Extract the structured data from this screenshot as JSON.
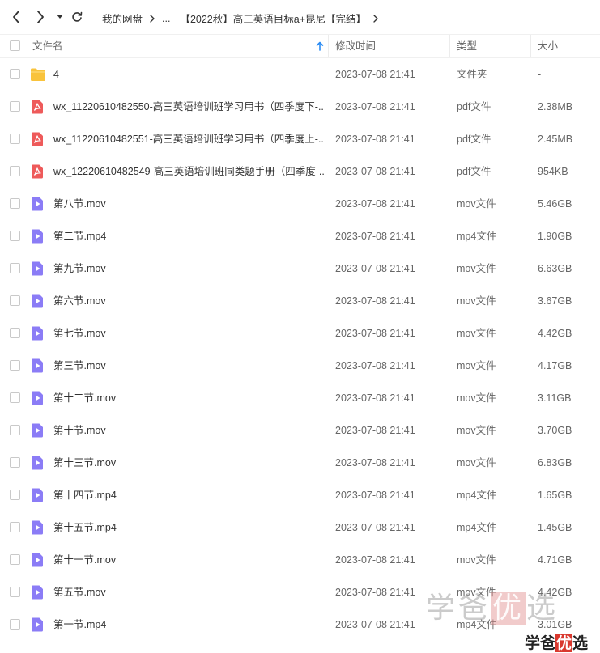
{
  "toolbar": {
    "back_icon": "chevron-left-icon",
    "forward_icon": "chevron-right-icon",
    "history_icon": "caret-down-icon",
    "refresh_icon": "refresh-icon"
  },
  "breadcrumb": {
    "items": [
      "我的网盘",
      "...",
      "【2022秋】高三英语目标a+昆尼【完结】"
    ]
  },
  "table": {
    "headers": {
      "name": "文件名",
      "modified": "修改时间",
      "type": "类型",
      "size": "大小"
    },
    "sort_icon": "arrow-up-icon",
    "rows": [
      {
        "icon": "folder-icon",
        "name": "4",
        "modified": "2023-07-08 21:41",
        "type": "文件夹",
        "size": "-"
      },
      {
        "icon": "pdf-icon",
        "name": "wx_11220610482550-高三英语培训班学习用书（四季度下-...",
        "modified": "2023-07-08 21:41",
        "type": "pdf文件",
        "size": "2.38MB"
      },
      {
        "icon": "pdf-icon",
        "name": "wx_11220610482551-高三英语培训班学习用书（四季度上-...",
        "modified": "2023-07-08 21:41",
        "type": "pdf文件",
        "size": "2.45MB"
      },
      {
        "icon": "pdf-icon",
        "name": "wx_12220610482549-高三英语培训班同类题手册（四季度-...",
        "modified": "2023-07-08 21:41",
        "type": "pdf文件",
        "size": "954KB"
      },
      {
        "icon": "video-icon",
        "name": "第八节.mov",
        "modified": "2023-07-08 21:41",
        "type": "mov文件",
        "size": "5.46GB"
      },
      {
        "icon": "video-icon",
        "name": "第二节.mp4",
        "modified": "2023-07-08 21:41",
        "type": "mp4文件",
        "size": "1.90GB"
      },
      {
        "icon": "video-icon",
        "name": "第九节.mov",
        "modified": "2023-07-08 21:41",
        "type": "mov文件",
        "size": "6.63GB"
      },
      {
        "icon": "video-icon",
        "name": "第六节.mov",
        "modified": "2023-07-08 21:41",
        "type": "mov文件",
        "size": "3.67GB"
      },
      {
        "icon": "video-icon",
        "name": "第七节.mov",
        "modified": "2023-07-08 21:41",
        "type": "mov文件",
        "size": "4.42GB"
      },
      {
        "icon": "video-icon",
        "name": "第三节.mov",
        "modified": "2023-07-08 21:41",
        "type": "mov文件",
        "size": "4.17GB"
      },
      {
        "icon": "video-icon",
        "name": "第十二节.mov",
        "modified": "2023-07-08 21:41",
        "type": "mov文件",
        "size": "3.11GB"
      },
      {
        "icon": "video-icon",
        "name": "第十节.mov",
        "modified": "2023-07-08 21:41",
        "type": "mov文件",
        "size": "3.70GB"
      },
      {
        "icon": "video-icon",
        "name": "第十三节.mov",
        "modified": "2023-07-08 21:41",
        "type": "mov文件",
        "size": "6.83GB"
      },
      {
        "icon": "video-icon",
        "name": "第十四节.mp4",
        "modified": "2023-07-08 21:41",
        "type": "mp4文件",
        "size": "1.65GB"
      },
      {
        "icon": "video-icon",
        "name": "第十五节.mp4",
        "modified": "2023-07-08 21:41",
        "type": "mp4文件",
        "size": "1.45GB"
      },
      {
        "icon": "video-icon",
        "name": "第十一节.mov",
        "modified": "2023-07-08 21:41",
        "type": "mov文件",
        "size": "4.71GB"
      },
      {
        "icon": "video-icon",
        "name": "第五节.mov",
        "modified": "2023-07-08 21:41",
        "type": "mov文件",
        "size": "4.42GB"
      },
      {
        "icon": "video-icon",
        "name": "第一节.mp4",
        "modified": "2023-07-08 21:41",
        "type": "mp4文件",
        "size": "3.01GB"
      }
    ]
  },
  "watermark": {
    "text_a": "学爸",
    "text_b": "优",
    "text_c": "选"
  },
  "logo": {
    "text_a": "学爸",
    "text_b": "优",
    "text_c": "选"
  },
  "colors": {
    "folder": "#F9C33C",
    "pdf": "#EE5A5A",
    "video": "#8B7CF6",
    "sort_arrow": "#2B8CF3",
    "logo_highlight": "#D9382E"
  }
}
